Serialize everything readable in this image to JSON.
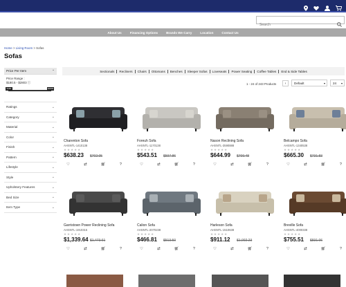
{
  "header": {
    "icons": [
      "location-pin-icon",
      "heart-icon",
      "user-icon",
      "cart-icon"
    ],
    "search_placeholder": "Search"
  },
  "nav": [
    "About Us",
    "Financing Options",
    "Brands We Carry",
    "Location",
    "Contact Us"
  ],
  "breadcrumb": {
    "home": "Home",
    "sep1": " > ",
    "parent": "Living Room",
    "sep2": " > ",
    "current": "Sofas"
  },
  "page_title": "Sofas",
  "sidebar": {
    "price_label": "Price Per Item",
    "price_range_label": "Price Range :",
    "price_range_value": "$180.5 - $2803 ⓘ",
    "slider_min": "$180",
    "slider_max": "$2803",
    "facets": [
      "Ratings",
      "Category",
      "Material",
      "Color",
      "Finish",
      "Pattern",
      "Lifestyle",
      "Style",
      "Upholstery Features",
      "Bed Size",
      "Item Type"
    ]
  },
  "categories": [
    "Sectionals",
    "Recliners",
    "Chairs",
    "Ottomans",
    "Benches",
    "Sleeper Sofas",
    "Loveseats",
    "Power Seating",
    "Coffee Tables",
    "End & Side Tables"
  ],
  "results_text": "1 - 24 of 243 Products",
  "sort_value": "Default",
  "per_page_value": "24",
  "colors": {
    "header_blue": "#1d2b6b",
    "nav_gray": "#a8a8a8",
    "link_blue": "#2a4db0"
  },
  "products": [
    {
      "name": "Charenton Sofa",
      "sku": "AHSNTL-1410138",
      "price": "$638.23",
      "was": "$702.05",
      "stars": "★★★★★",
      "color": "dark-charcoal"
    },
    {
      "name": "Foreuh Sofa",
      "sku": "AHSNTL-1170138",
      "price": "$543.51",
      "was": "$597.86",
      "stars": "★★★★★",
      "color": "light-gray"
    },
    {
      "name": "Nason Reclining Sofa",
      "sku": "AHSNTL-3590888",
      "price": "$644.99",
      "was": "$709.48",
      "stars": "★★★★★",
      "color": "taupe"
    },
    {
      "name": "Belcampo Sofa",
      "sku": "AHSNTL-1340538",
      "price": "$665.30",
      "was": "$731.83",
      "stars": "★★★★★",
      "color": "beige"
    },
    {
      "name": "Garristown Power Reclining Sofa",
      "sku": "AHSNTL-1910315",
      "price": "$1,339.64",
      "was": "$1,473.61",
      "stars": "★★★★★",
      "color": "dark-gray"
    },
    {
      "name": "Calion Sofa",
      "sku": "AHSNTL-2070238",
      "price": "$466.81",
      "was": "$513.50",
      "stars": "★★★★★",
      "color": "slate"
    },
    {
      "name": "Harleson Sofa",
      "sku": "AHSNTL-1510638",
      "price": "$911.12",
      "was": "$1,002.23",
      "stars": "★★★★★",
      "color": "cream"
    },
    {
      "name": "Breville Sofa",
      "sku": "AHSNTL-4000338",
      "price": "$755.51",
      "was": "$831.06",
      "stars": "★★★★★",
      "color": "brown"
    }
  ],
  "card_actions": [
    "heart-icon",
    "compare-icon",
    "cart-icon",
    "question-icon"
  ]
}
